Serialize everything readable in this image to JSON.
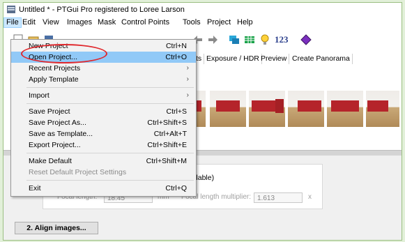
{
  "window": {
    "title": "Untitled * - PTGui Pro registered to Loree Larson"
  },
  "menubar": [
    "File",
    "Edit",
    "View",
    "Images",
    "Mask",
    "Control Points",
    "Tools",
    "Project",
    "Help"
  ],
  "toolbar": {
    "icons": [
      "new-project-icon",
      "open-project-icon",
      "save-icon",
      "arrow-left-icon",
      "arrow-right-icon",
      "panorama-editor-icon",
      "table-icon",
      "lightbulb-icon",
      "numbers-icon",
      "gem-icon"
    ],
    "numbers_label": "123"
  },
  "tabs": [
    "ts",
    "Exposure / HDR",
    "Preview",
    "Create Panorama"
  ],
  "file_menu": {
    "items": [
      {
        "label": "New Project",
        "shortcut": "Ctrl+N"
      },
      {
        "label": "Open Project...",
        "shortcut": "Ctrl+O",
        "highlighted": true
      },
      {
        "label": "Recent Projects",
        "submenu": true
      },
      {
        "label": "Apply Template",
        "submenu": true
      },
      {
        "label": "Import",
        "submenu": true
      },
      {
        "label": "Save Project",
        "shortcut": "Ctrl+S"
      },
      {
        "label": "Save Project As...",
        "shortcut": "Ctrl+Shift+S"
      },
      {
        "label": "Save as Template...",
        "shortcut": "Ctrl+Alt+T"
      },
      {
        "label": "Export Project...",
        "shortcut": "Ctrl+Shift+E"
      },
      {
        "label": "Make Default",
        "shortcut": "Ctrl+Shift+M"
      },
      {
        "label": "Reset Default Project Settings",
        "disabled": true
      },
      {
        "label": "Exit",
        "shortcut": "Ctrl+Q"
      }
    ]
  },
  "lens": {
    "availability_fragment": "vailable)",
    "focal_length_label": "Focal length:",
    "focal_length_value": "18.45",
    "focal_unit": "mm",
    "multiplier_label": "Focal length multiplier:",
    "multiplier_value": "1.613",
    "multiplier_suffix": "x"
  },
  "align_button": "2. Align images...",
  "colors": {
    "highlight": "#91c9f7",
    "annotation": "#e0282d",
    "page_bg": "#e2f0d9"
  }
}
